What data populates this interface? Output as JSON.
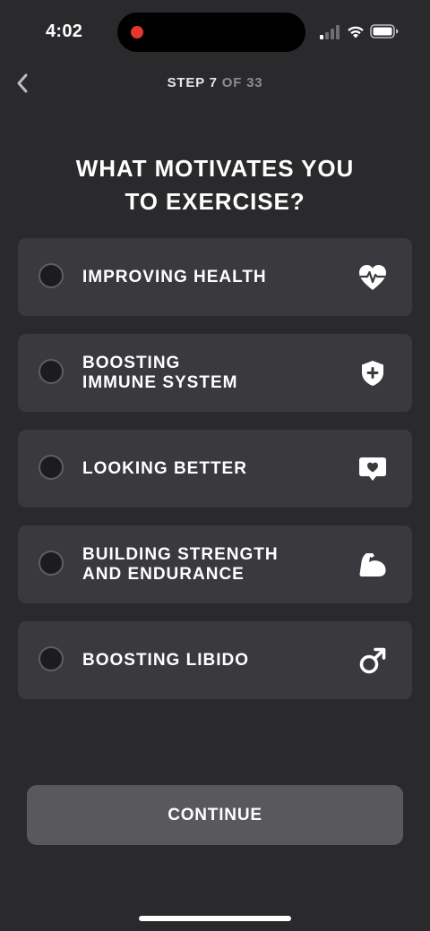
{
  "status_bar": {
    "time": "4:02"
  },
  "header": {
    "step_current": "STEP 7",
    "step_total": " OF 33"
  },
  "title": "WHAT MOTIVATES YOU\nTO EXERCISE?",
  "options": [
    {
      "label": "IMPROVING HEALTH",
      "icon": "heart-pulse-icon",
      "selected": false
    },
    {
      "label": "BOOSTING\nIMMUNE SYSTEM",
      "icon": "shield-plus-icon",
      "selected": false
    },
    {
      "label": "LOOKING BETTER",
      "icon": "heart-message-icon",
      "selected": false
    },
    {
      "label": "BUILDING STRENGTH\nAND ENDURANCE",
      "icon": "flexed-bicep-icon",
      "selected": false
    },
    {
      "label": "BOOSTING LIBIDO",
      "icon": "male-symbol-icon",
      "selected": false
    }
  ],
  "continue_label": "CONTINUE",
  "colors": {
    "background": "#2a292c",
    "card": "#3a393d",
    "button": "#59585c",
    "recording_dot": "#e5372c"
  }
}
